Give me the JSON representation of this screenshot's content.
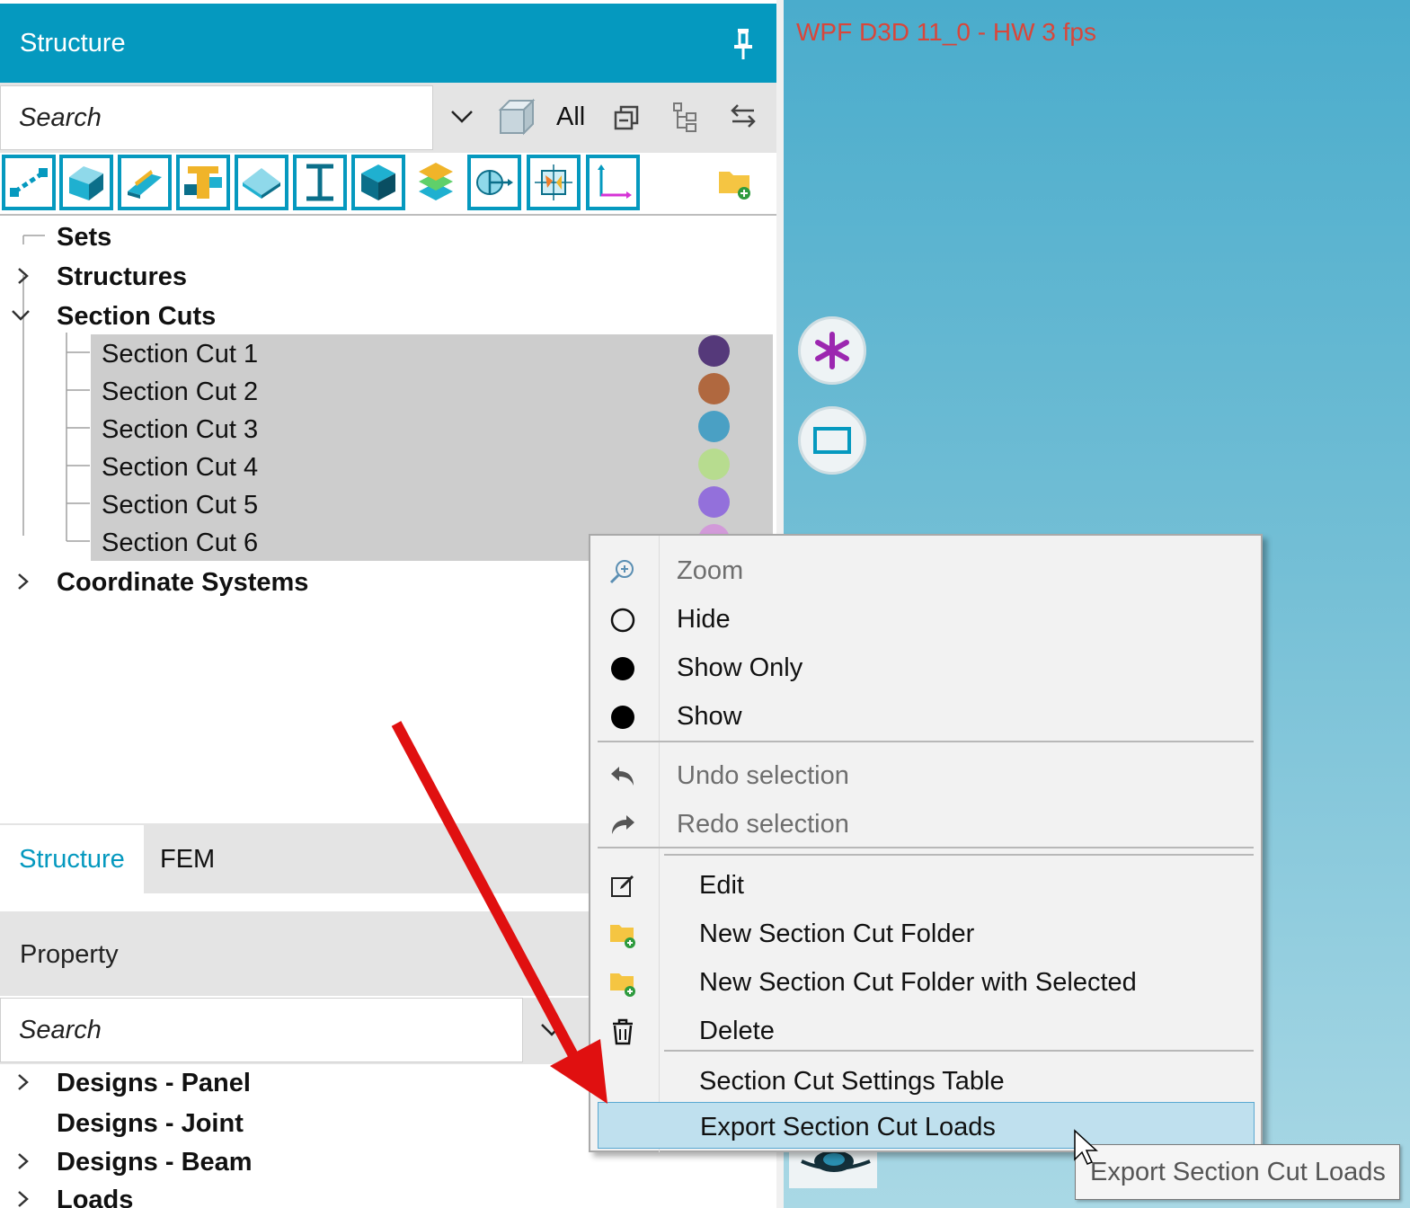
{
  "panel": {
    "title": "Structure",
    "pin_icon": "pin-icon"
  },
  "search": {
    "placeholder": "Search",
    "filter_label": "All"
  },
  "tree": {
    "sets": "Sets",
    "structures": "Structures",
    "section_cuts": "Section Cuts",
    "items": [
      {
        "label": "Section Cut 1",
        "color": "#55397a"
      },
      {
        "label": "Section Cut 2",
        "color": "#b0683f"
      },
      {
        "label": "Section Cut 3",
        "color": "#4aa0c4"
      },
      {
        "label": "Section Cut 4",
        "color": "#b7dc8f"
      },
      {
        "label": "Section Cut 5",
        "color": "#9370db"
      },
      {
        "label": "Section Cut 6",
        "color": "#d29ad9"
      }
    ],
    "coordinate_systems": "Coordinate Systems"
  },
  "tabs": {
    "structure": "Structure",
    "fem": "FEM"
  },
  "property": {
    "title": "Property",
    "search_placeholder": "Search",
    "items": [
      "Designs - Panel",
      "Designs - Joint",
      "Designs - Beam",
      "Loads"
    ]
  },
  "viewport": {
    "title": "WPF D3D 11_0 - HW  3 fps"
  },
  "context_menu": {
    "zoom": "Zoom",
    "hide": "Hide",
    "show_only": "Show Only",
    "show": "Show",
    "undo": "Undo selection",
    "redo": "Redo selection",
    "edit": "Edit",
    "new_folder": "New Section Cut Folder",
    "new_folder_selected": "New Section Cut Folder with Selected",
    "delete": "Delete",
    "settings_table": "Section Cut Settings Table",
    "export": "Export Section Cut Loads"
  },
  "tooltip": "Export Section Cut Loads",
  "colors": {
    "accent": "#0599bf",
    "arrow": "#e01010",
    "menu_highlight": "#bfe0ee"
  }
}
